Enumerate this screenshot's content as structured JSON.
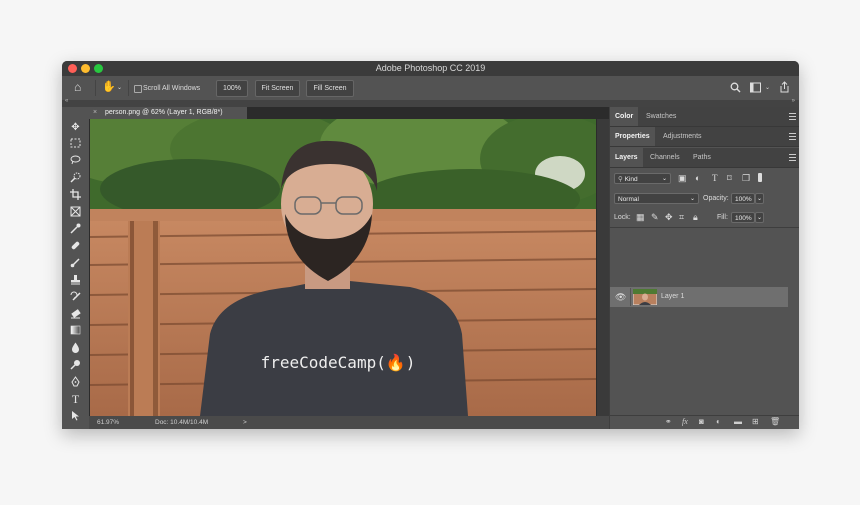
{
  "window": {
    "title": "Adobe Photoshop CC 2019"
  },
  "options_bar": {
    "scroll_all_windows": "Scroll All Windows",
    "zoom_value": "100%",
    "fit_screen": "Fit Screen",
    "fill_screen": "Fill Screen"
  },
  "document": {
    "tab_title": "person.png @ 62% (Layer 1, RGB/8*)",
    "shirt_text": "freeCodeCamp(🔥)",
    "status_zoom": "61.97%",
    "status_doc": "Doc: 10.4M/10.4M",
    "status_arrow": ">"
  },
  "panels": {
    "color_tab": "Color",
    "swatches_tab": "Swatches",
    "properties_tab": "Properties",
    "adjustments_tab": "Adjustments",
    "layers_tab": "Layers",
    "channels_tab": "Channels",
    "paths_tab": "Paths",
    "kind_filter": "Kind",
    "blend_mode": "Normal",
    "opacity_label": "Opacity:",
    "opacity_value": "100%",
    "lock_label": "Lock:",
    "fill_label": "Fill:",
    "fill_value": "100%",
    "layer_name": "Layer 1"
  },
  "colors": {
    "app_bg": "#535353",
    "titlebar": "#3b3b3b",
    "highlight_row": "#6f6f6f"
  }
}
